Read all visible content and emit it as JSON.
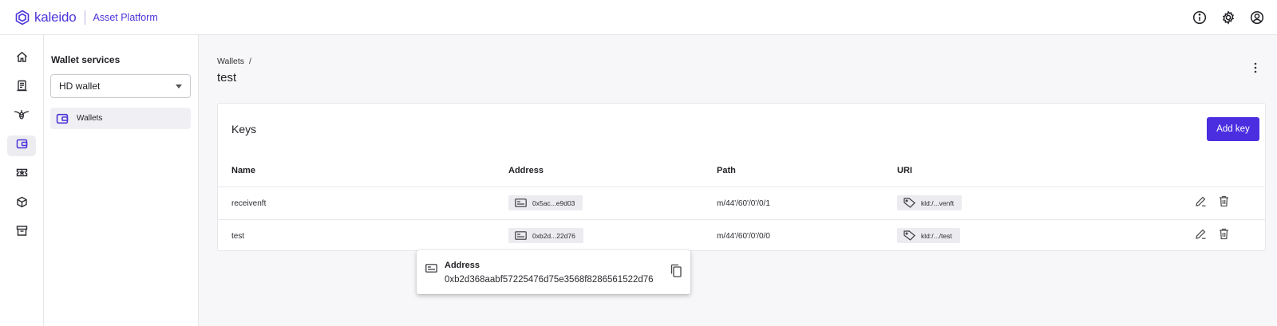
{
  "brand": {
    "name": "kaleido",
    "product": "Asset Platform"
  },
  "header_icons": [
    "info-icon",
    "gear-icon",
    "account-icon"
  ],
  "rail_items": [
    "home-icon",
    "document-icon",
    "bee-icon",
    "wallet-icon",
    "ticket-icon",
    "cube-icon",
    "archive-icon"
  ],
  "panel": {
    "title": "Wallet services",
    "select_value": "HD wallet",
    "nav_item": "Wallets"
  },
  "breadcrumb": {
    "parent": "Wallets",
    "separator": "/"
  },
  "page_title": "test",
  "keys": {
    "title": "Keys",
    "add_label": "Add key",
    "columns": {
      "name": "Name",
      "address": "Address",
      "path": "Path",
      "uri": "URI"
    },
    "rows": [
      {
        "name": "receivenft",
        "address": "0x5ac...e9d03",
        "path": "m/44'/60'/0'/0/1",
        "uri": "kld:/...venft"
      },
      {
        "name": "test",
        "address": "0xb2d...22d76",
        "path": "m/44'/60'/0'/0/0",
        "uri": "kld:/.../test"
      }
    ]
  },
  "popover": {
    "label": "Address",
    "value": "0xb2d368aabf57225476d75e3568f8286561522d76"
  },
  "colors": {
    "accent": "#4a2ee0",
    "brand": "#4b34d8"
  }
}
